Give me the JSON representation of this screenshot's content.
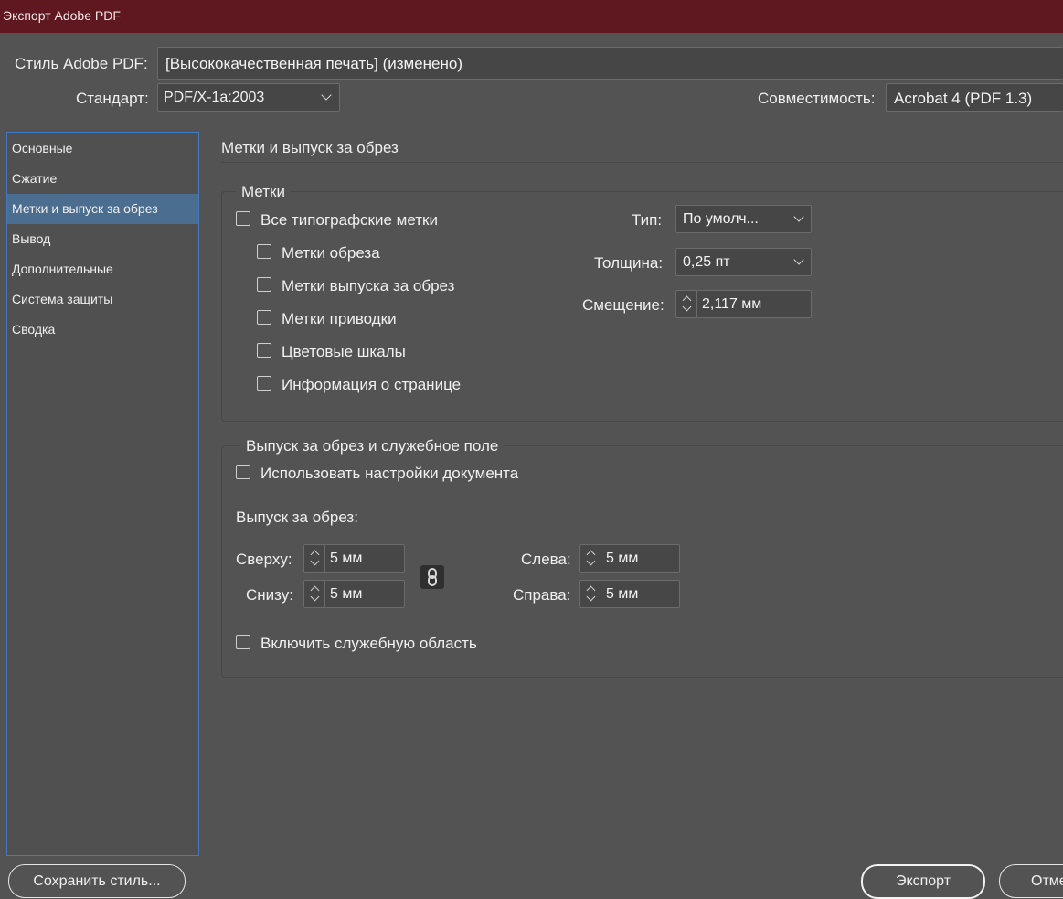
{
  "window": {
    "title": "Экспорт Adobe PDF"
  },
  "header": {
    "style_label": "Стиль Adobe PDF:",
    "style_value": "[Высококачественная печать] (изменено)",
    "standard_label": "Стандарт:",
    "standard_value": "PDF/X-1a:2003",
    "compat_label": "Совместимость:",
    "compat_value": "Acrobat 4 (PDF 1.3)"
  },
  "sidebar": {
    "items": [
      {
        "label": "Основные",
        "selected": false
      },
      {
        "label": "Сжатие",
        "selected": false
      },
      {
        "label": "Метки и выпуск за обрез",
        "selected": true
      },
      {
        "label": "Вывод",
        "selected": false
      },
      {
        "label": "Дополнительные",
        "selected": false
      },
      {
        "label": "Система защиты",
        "selected": false
      },
      {
        "label": "Сводка",
        "selected": false
      }
    ]
  },
  "panel": {
    "title": "Метки и выпуск за обрез",
    "marks": {
      "legend": "Метки",
      "all_marks": {
        "label": "Все типографские метки",
        "checked": false
      },
      "items": [
        {
          "label": "Метки обреза",
          "checked": false
        },
        {
          "label": "Метки выпуска за обрез",
          "checked": false
        },
        {
          "label": "Метки приводки",
          "checked": false
        },
        {
          "label": "Цветовые шкалы",
          "checked": false
        },
        {
          "label": "Информация о странице",
          "checked": false
        }
      ],
      "type_label": "Тип:",
      "type_value": "По умолч...",
      "weight_label": "Толщина:",
      "weight_value": "0,25 пт",
      "offset_label": "Смещение:",
      "offset_value": "2,117 мм"
    },
    "bleed": {
      "legend": "Выпуск за обрез и служебное поле",
      "use_doc": {
        "label": "Использовать настройки документа",
        "checked": false
      },
      "bleed_label": "Выпуск за обрез:",
      "top_label": "Сверху:",
      "top_value": "5 мм",
      "bottom_label": "Снизу:",
      "bottom_value": "5 мм",
      "left_label": "Слева:",
      "left_value": "5 мм",
      "right_label": "Справа:",
      "right_value": "5 мм",
      "slug": {
        "label": "Включить служебную область",
        "checked": false
      }
    }
  },
  "footer": {
    "save_style_label": "Сохранить стиль...",
    "export_label": "Экспорт",
    "cancel_label": "Отмена"
  },
  "icons": {
    "link": "link-chain-icon"
  }
}
